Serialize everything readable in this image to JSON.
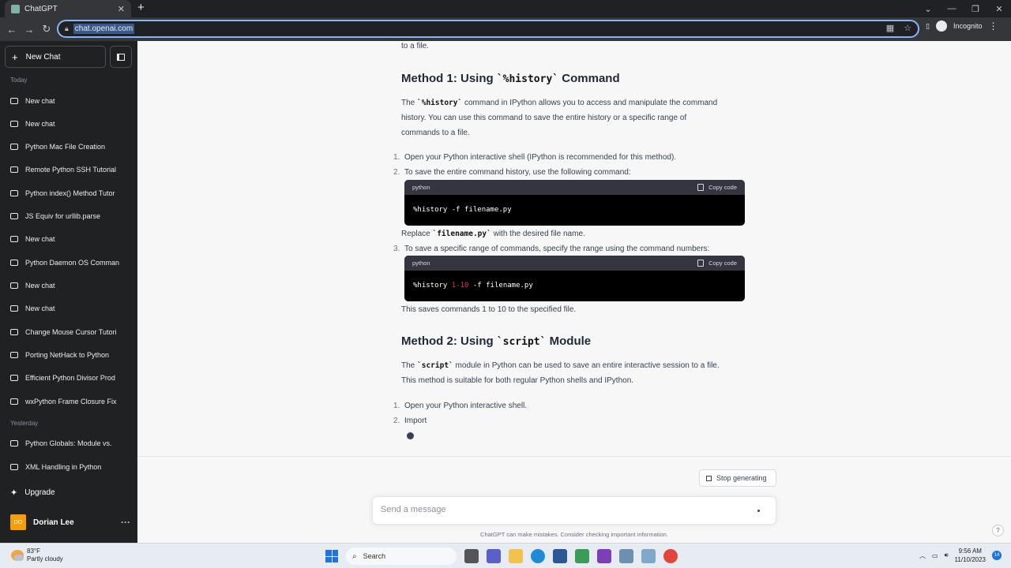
{
  "browser": {
    "tab_title": "ChatGPT",
    "url": "chat.openai.com",
    "incognito_label": "Incognito"
  },
  "sidebar": {
    "new_chat": "New Chat",
    "today_label": "Today",
    "yesterday_label": "Yesterday",
    "today_items": [
      "New chat",
      "New chat",
      "Python Mac File Creation",
      "Remote Python SSH Tutorial",
      "Python index() Method Tutor",
      "JS Equiv for urllib.parse",
      "New chat",
      "Python Daemon OS Comman",
      "New chat",
      "New chat",
      "Change Mouse Cursor Tutori",
      "Porting NetHack to Python",
      "Efficient Python Divisor Prod",
      "wxPython Frame Closure Fix"
    ],
    "yesterday_items": [
      "Python Globals: Module vs.",
      "XML Handling in Python"
    ],
    "upgrade": "Upgrade",
    "user_initials": "DO",
    "user_name": "Dorian Lee"
  },
  "content": {
    "top_fragment": "to a file.",
    "m1_pre": "Method 1: Using ",
    "m1_code": "`%history`",
    "m1_post": " Command",
    "m1_p1_pre": "The ",
    "m1_p1_code": "`%history`",
    "m1_p1_post": " command in IPython allows you to access and manipulate the command",
    "m1_p2": "history. You can use this command to save the entire history or a specific range of",
    "m1_p3": "commands to a file.",
    "step1_num": "1.",
    "step1": "Open your Python interactive shell (IPython is recommended for this method).",
    "step2_num": "2.",
    "step2": "To save the entire command history, use the following command:",
    "code1_lang": "python",
    "copy_label": "Copy code",
    "code1": "%history -f filename.py",
    "replace_pre": "Replace ",
    "replace_code": "`filename.py`",
    "replace_post": " with the desired file name.",
    "step3_num": "3.",
    "step3": "To save a specific range of commands, specify the range using the command numbers:",
    "code2_lang": "python",
    "code2_a": "%history ",
    "code2_b": "1-10",
    "code2_c": " -f filename.py",
    "saves": "This saves commands 1 to 10 to the specified file.",
    "m2_pre": "Method 2: Using ",
    "m2_code": "`script`",
    "m2_post": " Module",
    "m2_p1_pre": "The ",
    "m2_p1_code": "`script`",
    "m2_p1_post": " module in Python can be used to save an entire interactive session to a file.",
    "m2_p2": "This method is suitable for both regular Python shells and IPython.",
    "m2_step1_num": "1.",
    "m2_step1": "Open your Python interactive shell.",
    "m2_step2_num": "2.",
    "m2_step2": "Import"
  },
  "composer": {
    "stop": "Stop generating",
    "placeholder": "Send a message",
    "disclaimer": "ChatGPT can make mistakes. Consider checking important information.",
    "help": "?"
  },
  "taskbar": {
    "temp": "83°F",
    "weather": "Partly cloudy",
    "search": "Search",
    "time": "9:56 AM",
    "date": "11/10/2023",
    "notif_count": "14"
  }
}
